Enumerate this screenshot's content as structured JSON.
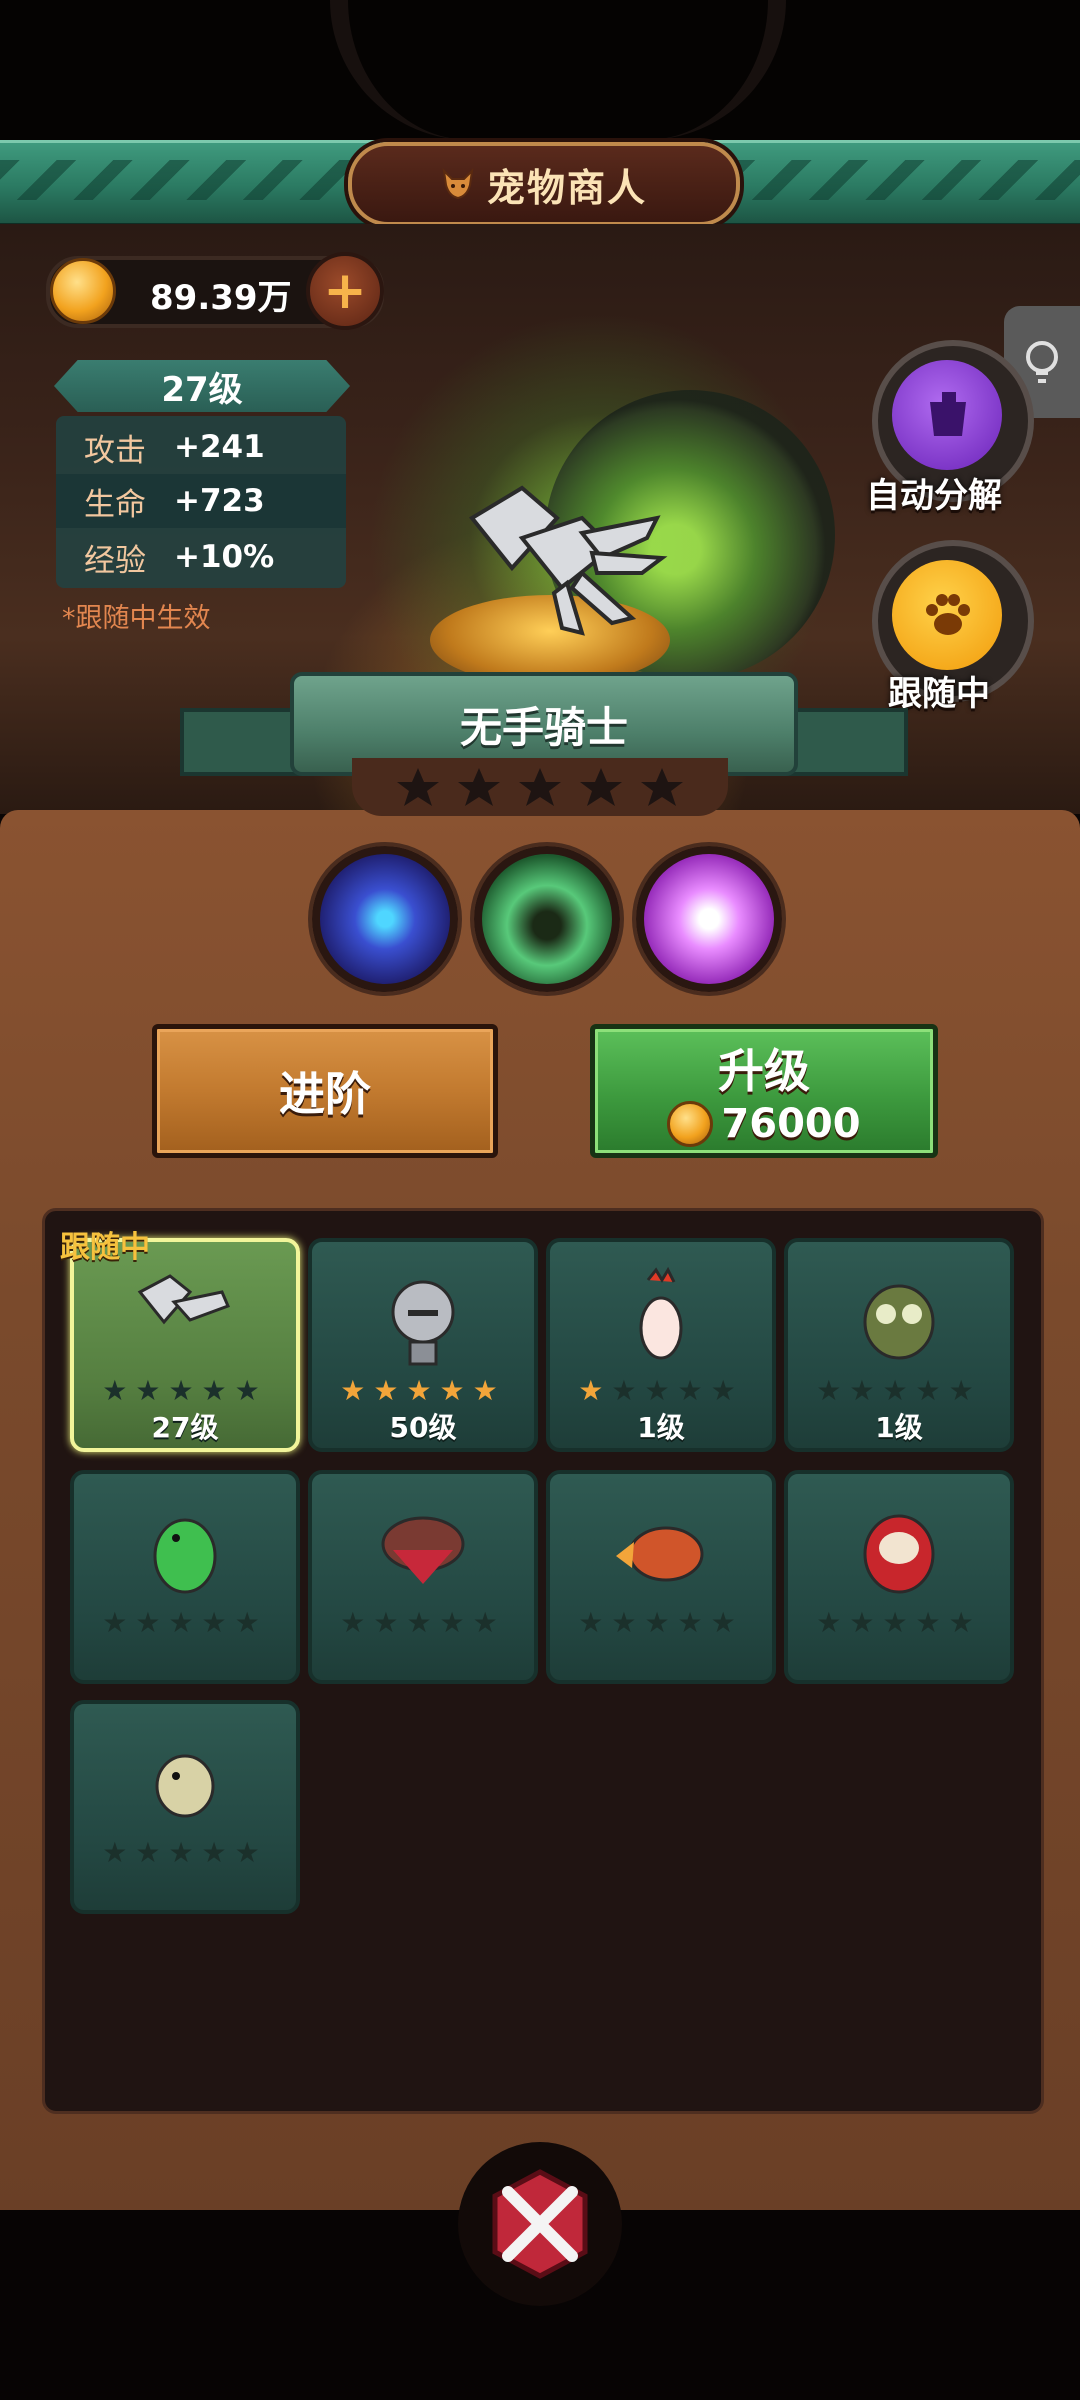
{
  "header": {
    "title": "宠物商人",
    "title_icon": "fox-icon"
  },
  "currency": {
    "amount": "89.39万",
    "add_label": "+"
  },
  "pet_stats": {
    "level": "27级",
    "rows": [
      {
        "name": "攻击",
        "value": "+241"
      },
      {
        "name": "生命",
        "value": "+723"
      },
      {
        "name": "经验",
        "value": "+10%"
      }
    ],
    "note": "*跟随中生效"
  },
  "side_buttons": {
    "auto_decompose": "自动分解",
    "following": "跟随中"
  },
  "pet": {
    "name": "无手骑士",
    "stars": 0,
    "max_stars": 5
  },
  "skills": [
    "ninja-eye-skill-icon",
    "claw-skill-icon",
    "speech-burst-skill-icon"
  ],
  "actions": {
    "advance_label": "进阶",
    "upgrade_label": "升级",
    "upgrade_cost": "76000"
  },
  "pet_list": {
    "following_tag": "跟随中",
    "items": [
      {
        "name": "gauntlet-pet",
        "stars": 0,
        "level": "27级",
        "selected": true
      },
      {
        "name": "knight-helmet-pet",
        "stars": 5,
        "level": "50级",
        "selected": false
      },
      {
        "name": "rooster-pet",
        "stars": 1,
        "level": "1级",
        "selected": false
      },
      {
        "name": "owl-skull-pet",
        "stars": 0,
        "level": "1级",
        "selected": false
      },
      {
        "name": "green-bird-pet",
        "stars": 0,
        "level": "",
        "selected": false
      },
      {
        "name": "carnivorous-plant-pet",
        "stars": 0,
        "level": "",
        "selected": false
      },
      {
        "name": "fire-dragon-pet",
        "stars": 0,
        "level": "",
        "selected": false
      },
      {
        "name": "daruma-pet",
        "stars": 0,
        "level": "",
        "selected": false
      },
      {
        "name": "zombie-chick-pet",
        "stars": 0,
        "level": "",
        "selected": false
      }
    ]
  },
  "colors": {
    "banner_green": "#2b7a62",
    "panel_brown": "#7a4a2c",
    "card_green": "#2f5a52",
    "star_gold": "#f2a53a",
    "upgrade_green": "#3d9a3e",
    "advance_orange": "#c27a2f"
  }
}
